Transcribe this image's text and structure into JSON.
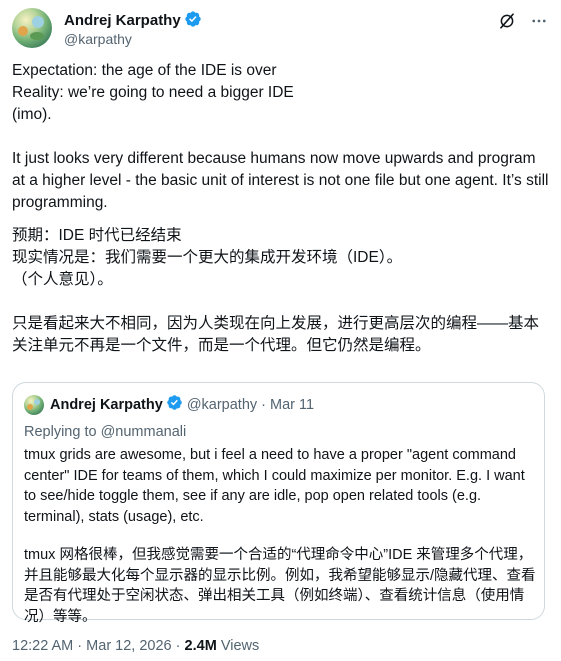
{
  "author": {
    "name": "Andrej Karpathy",
    "handle": "@karpathy",
    "verified": true,
    "verified_color": "#1d9bf0"
  },
  "header_icons": [
    "grok-icon",
    "more-icon"
  ],
  "tweet": {
    "lines_en_1": [
      "Expectation: the age of the IDE is over",
      "Reality: we’re going to need a bigger IDE",
      "(imo)."
    ],
    "para_en_2": "It just looks very different because humans now move upwards and program at a higher level - the basic unit of interest is not one file but one agent. It’s still programming.",
    "lines_zh_1": [
      "预期：IDE 时代已经结束",
      "现实情况是：我们需要一个更大的集成开发环境（IDE）。",
      "（个人意见）。"
    ],
    "para_zh_2": "只是看起来大不相同，因为人类现在向上发展，进行更高层次的编程——基本关注单元不再是一个文件，而是一个代理。但它仍然是编程。"
  },
  "quote": {
    "name": "Andrej Karpathy",
    "handle": "@karpathy",
    "separator": "·",
    "date": "Mar 11",
    "replying_to": "Replying to @nummanali",
    "para_en": "tmux grids are awesome, but i feel a need to have a proper \"agent command center\" IDE for teams of them, which I could maximize per monitor. E.g. I want to see/hide toggle them, see if any are idle, pop open related tools (e.g. terminal), stats (usage), etc.",
    "para_zh": "tmux 网格很棒，但我感觉需要一个合适的“代理命令中心”IDE 来管理多个代理，并且能够最大化每个显示器的显示比例。例如，我希望能够显示/隐藏代理、查看是否有代理处于空闲状态、弹出相关工具（例如终端）、查看统计信息（使用情况）等等。"
  },
  "footer": {
    "time": "12:22 AM",
    "separator": "·",
    "date": "Mar 12, 2026",
    "views_count": "2.4M",
    "views_label": "Views"
  },
  "colors": {
    "text": "#0f1419",
    "secondary": "#536471",
    "border": "#cfd9de",
    "accent": "#1d9bf0"
  }
}
